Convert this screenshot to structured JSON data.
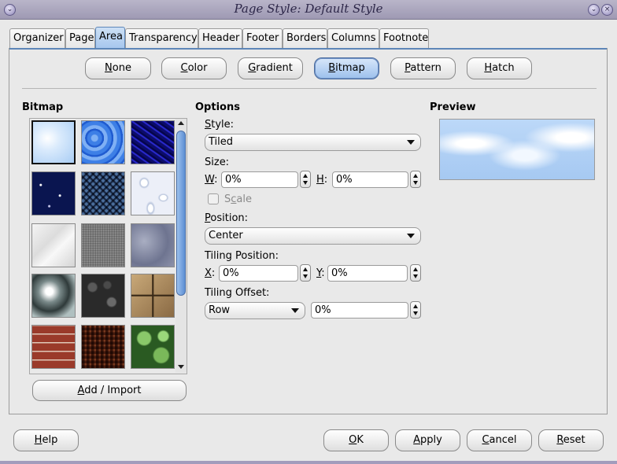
{
  "window": {
    "title": "Page Style: Default Style"
  },
  "tabs": [
    "Organizer",
    "Page",
    "Area",
    "Transparency",
    "Header",
    "Footer",
    "Borders",
    "Columns",
    "Footnote"
  ],
  "active_tab": "Area",
  "fill_buttons": {
    "none": {
      "pre": "",
      "key": "N",
      "post": "one"
    },
    "color": {
      "pre": "",
      "key": "C",
      "post": "olor"
    },
    "gradient": {
      "pre": "",
      "key": "G",
      "post": "radient"
    },
    "bitmap": {
      "pre": "",
      "key": "B",
      "post": "itmap"
    },
    "pattern": {
      "pre": "",
      "key": "P",
      "post": "attern"
    },
    "hatch": {
      "pre": "",
      "key": "H",
      "post": "atch"
    }
  },
  "selected_fill": "Bitmap",
  "bitmap_section": {
    "heading": "Bitmap",
    "tiles": [
      "Sky",
      "Water",
      "Coarse",
      "Space",
      "Metal weave",
      "Droplets",
      "Marble",
      "Linen",
      "Stone",
      "Mercury",
      "Gravel",
      "Wall",
      "Brownstone",
      "Weaving",
      "Leaves"
    ],
    "selected_tile": "Sky",
    "add_import": {
      "pre": "",
      "key": "A",
      "post": "dd / Import"
    }
  },
  "options": {
    "heading": "Options",
    "style_label": {
      "pre": "",
      "key": "S",
      "post": "tyle:"
    },
    "style_value": "Tiled",
    "size_label": "Size:",
    "w_label": {
      "key": "W",
      "post": ":"
    },
    "w_value": "0%",
    "h_label": {
      "key": "H",
      "post": ":"
    },
    "h_value": "0%",
    "scale_label": {
      "pre": "S",
      "key": "c",
      "post": "ale"
    },
    "scale_checked": false,
    "position_label": {
      "pre": "",
      "key": "P",
      "post": "osition:"
    },
    "position_value": "Center",
    "tiling_position_label": "Tiling Position:",
    "x_label": {
      "key": "X",
      "post": ":"
    },
    "x_value": "0%",
    "y_label": {
      "key": "Y",
      "post": ":"
    },
    "y_value": "0%",
    "tiling_offset_label": "Tiling Offset:",
    "offset_mode": "Row",
    "offset_value": "0%"
  },
  "preview": {
    "heading": "Preview"
  },
  "bottom_buttons": {
    "help": {
      "pre": "",
      "key": "H",
      "post": "elp"
    },
    "ok": {
      "pre": "",
      "key": "O",
      "post": "K"
    },
    "apply": {
      "pre": "",
      "key": "A",
      "post": "pply"
    },
    "cancel": {
      "pre": "",
      "key": "C",
      "post": "ancel"
    },
    "reset": {
      "pre": "",
      "key": "R",
      "post": "eset"
    }
  }
}
